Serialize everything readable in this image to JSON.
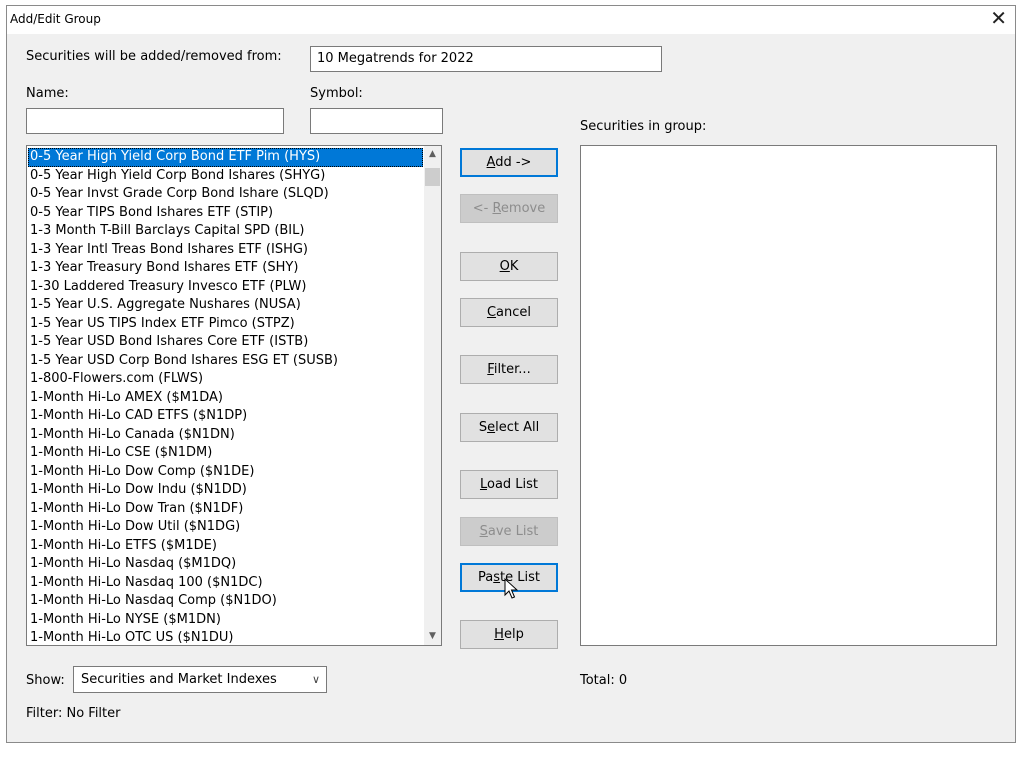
{
  "window": {
    "title": "Add/Edit Group",
    "close_glyph": "✕"
  },
  "target": {
    "label": "Securities will be added/removed from:",
    "value": "10 Megatrends for 2022"
  },
  "name_field": {
    "label": "Name:",
    "value": ""
  },
  "symbol_field": {
    "label": "Symbol:",
    "value": ""
  },
  "securities_list": {
    "items": [
      "0-5 Year High Yield Corp Bond ETF Pim (HYS)",
      "0-5 Year High Yield Corp Bond Ishares (SHYG)",
      "0-5 Year Invst Grade Corp Bond Ishare (SLQD)",
      "0-5 Year TIPS Bond Ishares ETF (STIP)",
      "1-3 Month T-Bill Barclays Capital SPD (BIL)",
      "1-3 Year Intl Treas Bond Ishares ETF (ISHG)",
      "1-3 Year Treasury Bond Ishares ETF (SHY)",
      "1-30 Laddered Treasury Invesco ETF (PLW)",
      "1-5 Year U.S. Aggregate Nushares (NUSA)",
      "1-5 Year US TIPS Index ETF Pimco (STPZ)",
      "1-5 Year USD Bond Ishares Core ETF (ISTB)",
      "1-5 Year USD Corp Bond Ishares ESG ET (SUSB)",
      "1-800-Flowers.com (FLWS)",
      "1-Month Hi-Lo AMEX ($M1DA)",
      "1-Month Hi-Lo CAD ETFS ($N1DP)",
      "1-Month Hi-Lo Canada ($N1DN)",
      "1-Month Hi-Lo CSE ($N1DM)",
      "1-Month Hi-Lo Dow Comp ($N1DE)",
      "1-Month Hi-Lo Dow Indu ($N1DD)",
      "1-Month Hi-Lo Dow Tran ($N1DF)",
      "1-Month Hi-Lo Dow Util ($N1DG)",
      "1-Month Hi-Lo ETFS ($M1DE)",
      "1-Month Hi-Lo Nasdaq ($M1DQ)",
      "1-Month Hi-Lo Nasdaq 100 ($N1DC)",
      "1-Month Hi-Lo Nasdaq Comp ($N1DO)",
      "1-Month Hi-Lo NYSE ($M1DN)",
      "1-Month Hi-Lo OTC US ($N1DU)"
    ],
    "selected_index": 0
  },
  "group_list": {
    "label": "Securities in group:"
  },
  "buttons": {
    "add": {
      "pre": "",
      "key": "A",
      "post": "dd ->"
    },
    "remove": {
      "pre": "<- ",
      "key": "R",
      "post": "emove"
    },
    "ok": {
      "pre": "",
      "key": "O",
      "post": "K"
    },
    "cancel": {
      "pre": "",
      "key": "C",
      "post": "ancel"
    },
    "filter": {
      "pre": "",
      "key": "F",
      "post": "ilter..."
    },
    "select_all": {
      "pre": "S",
      "key": "e",
      "post": "lect All"
    },
    "load_list": {
      "pre": "",
      "key": "L",
      "post": "oad List"
    },
    "save_list": {
      "pre": "",
      "key": "S",
      "post": "ave List"
    },
    "paste_list": {
      "pre": "Pa",
      "key": "s",
      "post": "te List"
    },
    "help": {
      "pre": "",
      "key": "H",
      "post": "elp"
    }
  },
  "show": {
    "label": "Show:",
    "value": "Securities and Market Indexes"
  },
  "total": {
    "text": "Total: 0"
  },
  "filter_status": {
    "text": "Filter: No Filter"
  },
  "colors": {
    "selection": "#0078d7",
    "dialog_bg": "#f0f0f0",
    "disabled_text": "#8d8d8d"
  }
}
